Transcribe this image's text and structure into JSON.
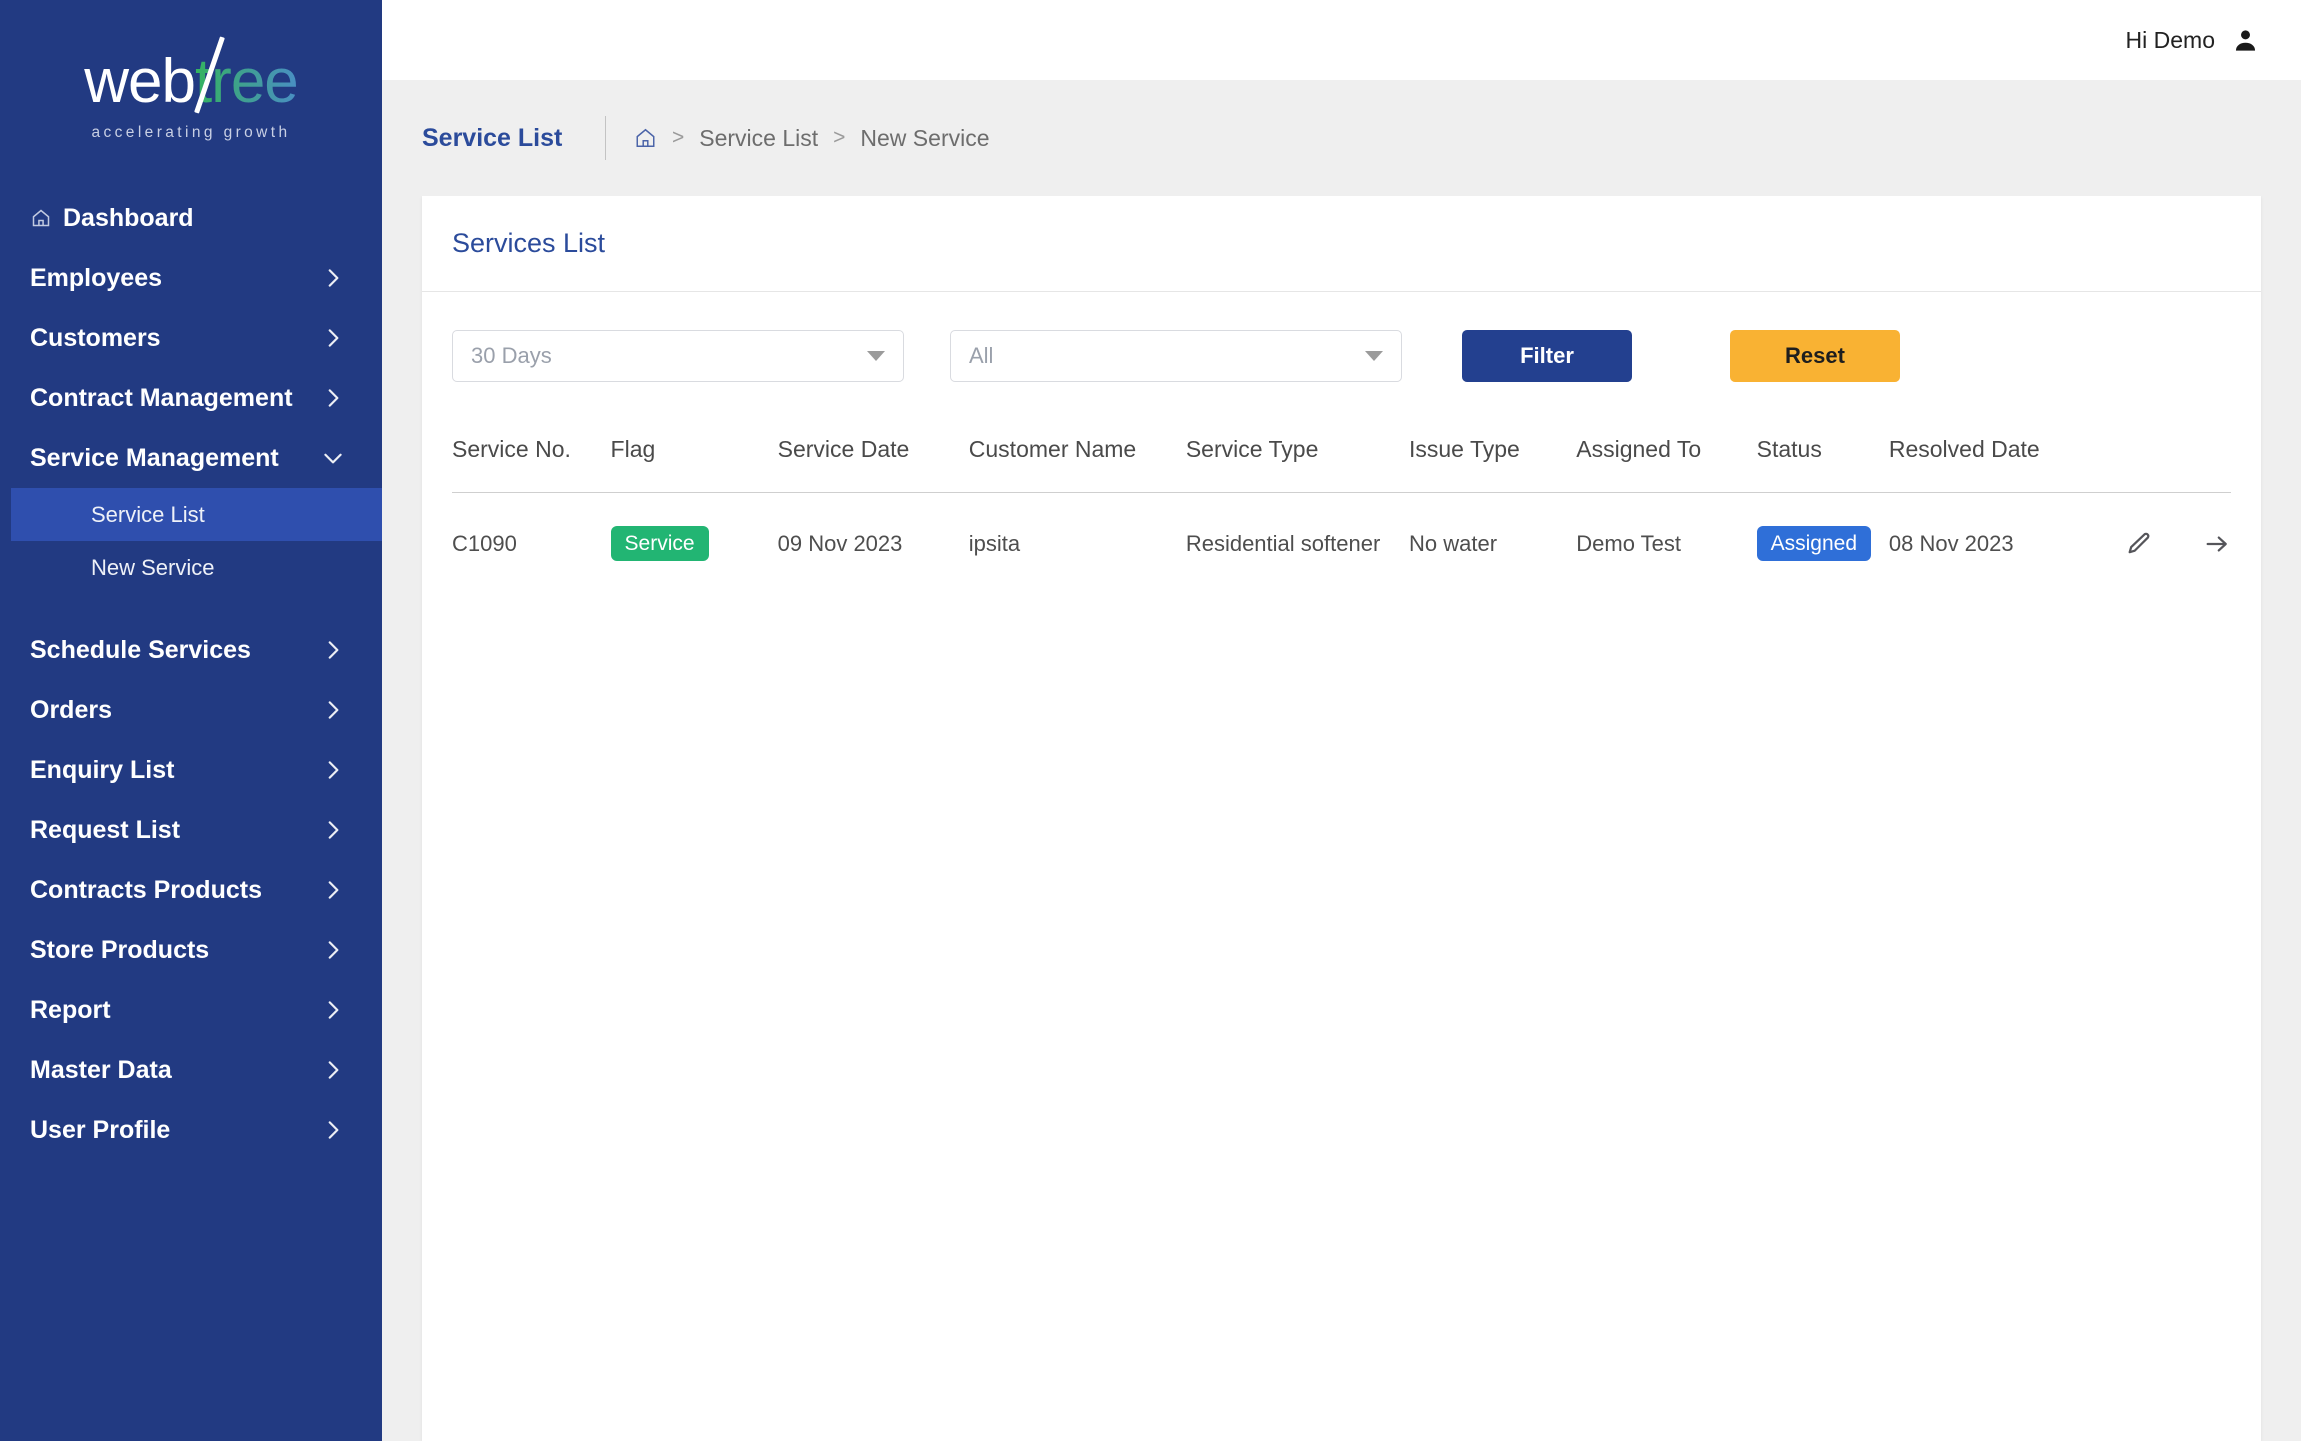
{
  "brand": {
    "logo_primary": "web",
    "logo_secondary": "tree",
    "tagline": "accelerating growth",
    "sidebar_color": "#223a82",
    "accent_blue": "#2b4b9b",
    "accent_orange": "#f9b233",
    "accent_green": "#22b573"
  },
  "topbar": {
    "greeting": "Hi Demo",
    "user_icon": "user-icon"
  },
  "breadcrumb": {
    "title": "Service List",
    "home_icon": "home-icon",
    "separator": ">",
    "items": [
      {
        "label": "Service List"
      },
      {
        "label": "New Service"
      }
    ]
  },
  "sidebar": {
    "items": [
      {
        "label": "Dashboard",
        "icon": "home-icon",
        "chevron": "none",
        "type": "link"
      },
      {
        "label": "Employees",
        "chevron": "chevron-right-icon",
        "type": "group"
      },
      {
        "label": "Customers",
        "chevron": "chevron-right-icon",
        "type": "group"
      },
      {
        "label": "Contract Management",
        "chevron": "chevron-right-icon",
        "type": "group"
      },
      {
        "label": "Service Management",
        "chevron": "chevron-down-icon",
        "type": "group",
        "expanded": true
      },
      {
        "label": "Schedule Services",
        "chevron": "chevron-right-icon",
        "type": "group"
      },
      {
        "label": "Orders",
        "chevron": "chevron-right-icon",
        "type": "group"
      },
      {
        "label": "Enquiry List",
        "chevron": "chevron-right-icon",
        "type": "group"
      },
      {
        "label": "Request List",
        "chevron": "chevron-right-icon",
        "type": "group"
      },
      {
        "label": "Contracts Products",
        "chevron": "chevron-right-icon",
        "type": "group"
      },
      {
        "label": "Store Products",
        "chevron": "chevron-right-icon",
        "type": "group"
      },
      {
        "label": "Report",
        "chevron": "chevron-right-icon",
        "type": "group"
      },
      {
        "label": "Master Data",
        "chevron": "chevron-right-icon",
        "type": "group"
      },
      {
        "label": "User Profile",
        "chevron": "chevron-right-icon",
        "type": "group"
      }
    ],
    "submenu": [
      {
        "label": "Service List",
        "active": true
      },
      {
        "label": "New Service",
        "active": false
      }
    ]
  },
  "card": {
    "title": "Services List"
  },
  "filters": {
    "period": {
      "value": "30 Days",
      "placeholder": "30 Days"
    },
    "status": {
      "value": "All",
      "placeholder": "All"
    },
    "filter_button": "Filter",
    "reset_button": "Reset"
  },
  "table": {
    "columns": [
      "Service No.",
      "Flag",
      "Service Date",
      "Customer Name",
      "Service Type",
      "Issue Type",
      "Assigned To",
      "Status",
      "Resolved Date"
    ],
    "rows": [
      {
        "service_no": "C1090",
        "flag": "Service",
        "service_date": "09 Nov 2023",
        "customer_name": "ipsita",
        "service_type": "Residential softener",
        "issue_type": "No water",
        "assigned_to": "Demo Test",
        "status": "Assigned",
        "resolved_date": "08 Nov 2023",
        "edit_icon": "pencil-icon",
        "forward_icon": "arrow-right-icon"
      }
    ]
  }
}
